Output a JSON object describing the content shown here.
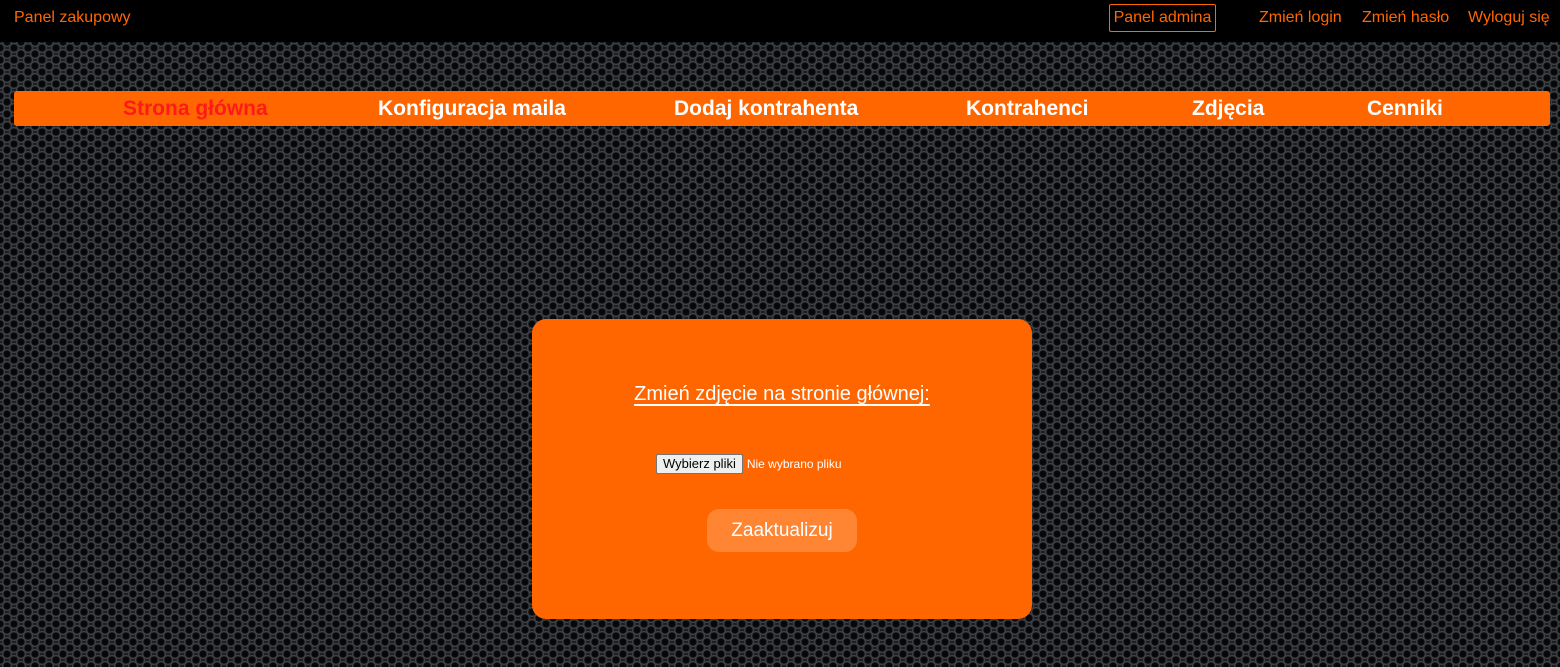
{
  "topbar": {
    "brand": "Panel zakupowy",
    "admin_button": "Panel admina",
    "links": {
      "change_login": "Zmień login",
      "change_password": "Zmień hasło",
      "logout": "Wyloguj się"
    }
  },
  "nav": {
    "items": [
      {
        "label": "Strona główna",
        "active": true
      },
      {
        "label": "Konfiguracja maila",
        "active": false
      },
      {
        "label": "Dodaj kontrahenta",
        "active": false
      },
      {
        "label": "Kontrahenci",
        "active": false
      },
      {
        "label": "Zdjęcia",
        "active": false
      },
      {
        "label": "Cenniki",
        "active": false
      }
    ]
  },
  "upload_form": {
    "title": "Zmień zdjęcie na stronie głównej:",
    "file_button": "Wybierz pliki",
    "file_status": "Nie wybrano pliku",
    "submit": "Zaaktualizuj"
  },
  "colors": {
    "accent": "#ff6600",
    "active_nav": "#ff1a1a",
    "topbar_bg": "#000000"
  }
}
